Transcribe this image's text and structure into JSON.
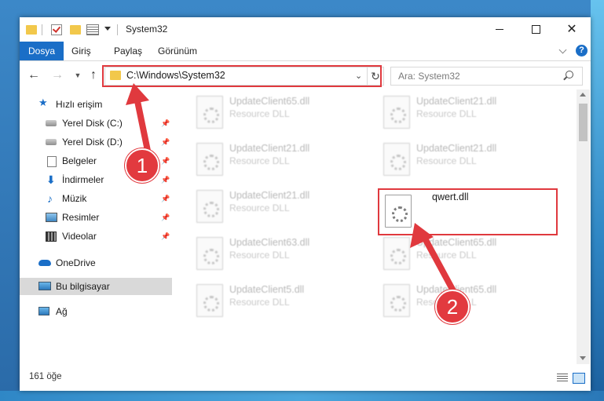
{
  "window": {
    "title": "System32",
    "controls": {
      "minimize": "—",
      "maximize": "□",
      "close": "✕"
    }
  },
  "ribbon": {
    "tabs": [
      "Dosya",
      "Giriş",
      "Paylaş",
      "Görünüm"
    ],
    "help": "?"
  },
  "address": {
    "path": "C:\\Windows\\System32",
    "search_placeholder": "Ara: System32"
  },
  "nav_pane": {
    "items": [
      {
        "label": "Hızlı erişim",
        "icon": "star-icon"
      },
      {
        "label": "Yerel Disk (C:)",
        "icon": "disk-icon",
        "pinned": true
      },
      {
        "label": "Yerel Disk (D:)",
        "icon": "disk-icon",
        "pinned": true
      },
      {
        "label": "Belgeler",
        "icon": "documents-icon",
        "pinned": true
      },
      {
        "label": "İndirmeler",
        "icon": "download-icon",
        "pinned": true
      },
      {
        "label": "Müzik",
        "icon": "music-icon",
        "pinned": true
      },
      {
        "label": "Resimler",
        "icon": "pictures-icon",
        "pinned": true
      },
      {
        "label": "Videolar",
        "icon": "video-icon",
        "pinned": true
      },
      {
        "label": "OneDrive",
        "icon": "cloud-icon"
      },
      {
        "label": "Bu bilgisayar",
        "icon": "computer-icon",
        "selected": true
      },
      {
        "label": "Ağ",
        "icon": "network-icon"
      }
    ]
  },
  "files": [
    {
      "name": "UpdateClient65.dll",
      "type": "Resource DLL"
    },
    {
      "name": "UpdateClient21.dll",
      "type": "Resource DLL"
    },
    {
      "name": "UpdateClient21.dll",
      "type": "Resource DLL"
    },
    {
      "name": "UpdateClient21.dll",
      "type": "Resource DLL"
    },
    {
      "name": "UpdateClient21.dll",
      "type": "Resource DLL"
    },
    {
      "name": "qwert.dll",
      "type": ""
    },
    {
      "name": "UpdateClient63.dll",
      "type": "Resource DLL"
    },
    {
      "name": "UpdateClient65.dll",
      "type": "Resource DLL"
    },
    {
      "name": "UpdateClient5.dll",
      "type": "Resource DLL"
    },
    {
      "name": "UpdateClient65.dll",
      "type": "Resource DLL"
    }
  ],
  "status": {
    "item_count": "161 öğe"
  },
  "annotations": {
    "step1": "1",
    "step2": "2",
    "color": "#e0393e"
  }
}
